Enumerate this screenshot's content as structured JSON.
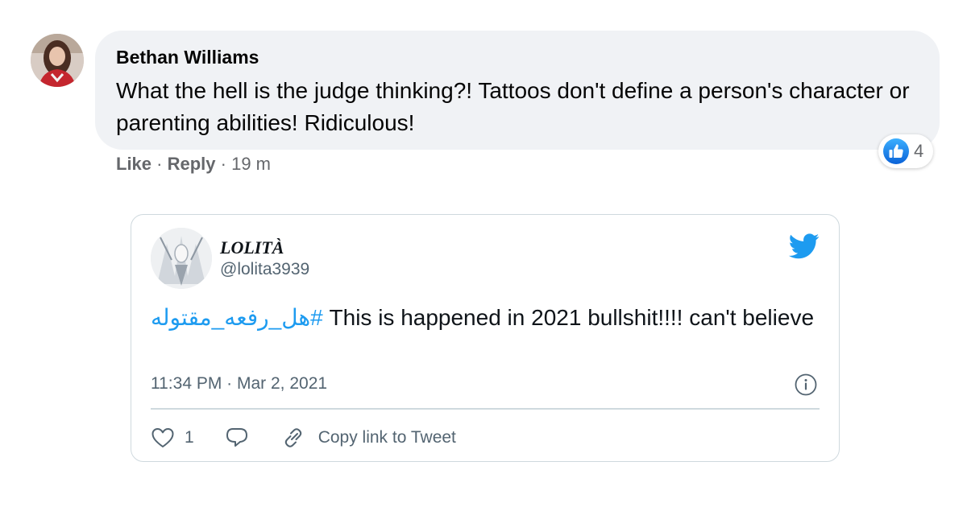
{
  "comment": {
    "author": "Bethan Williams",
    "text": "What the hell is the judge thinking?! Tattoos don't define a person's character or parenting abilities! Ridiculous!",
    "reaction_icon": "like-icon",
    "reaction_count": "4",
    "actions": {
      "like_label": "Like",
      "separator": " · ",
      "reply_label": "Reply",
      "time": "19 m"
    }
  },
  "tweet": {
    "display_name": "LOLITÀ",
    "handle": "@lolita3939",
    "hashtag": "#هل_رفعه_مقتوله",
    "text": " This is happened in 2021 bullshit!!!! can't believe",
    "timestamp": "11:34 PM · Mar 2, 2021",
    "like_count": "1",
    "copy_link_label": "Copy link to Tweet",
    "icons": [
      "twitter-bird-icon",
      "info-icon",
      "heart-icon",
      "reply-bubble-icon",
      "link-icon"
    ]
  },
  "colors": {
    "twitter_blue": "#1d9bf0",
    "facebook_blue": "#1877f2",
    "bubble_bg": "#f0f2f5",
    "muted_text": "#65676b"
  }
}
